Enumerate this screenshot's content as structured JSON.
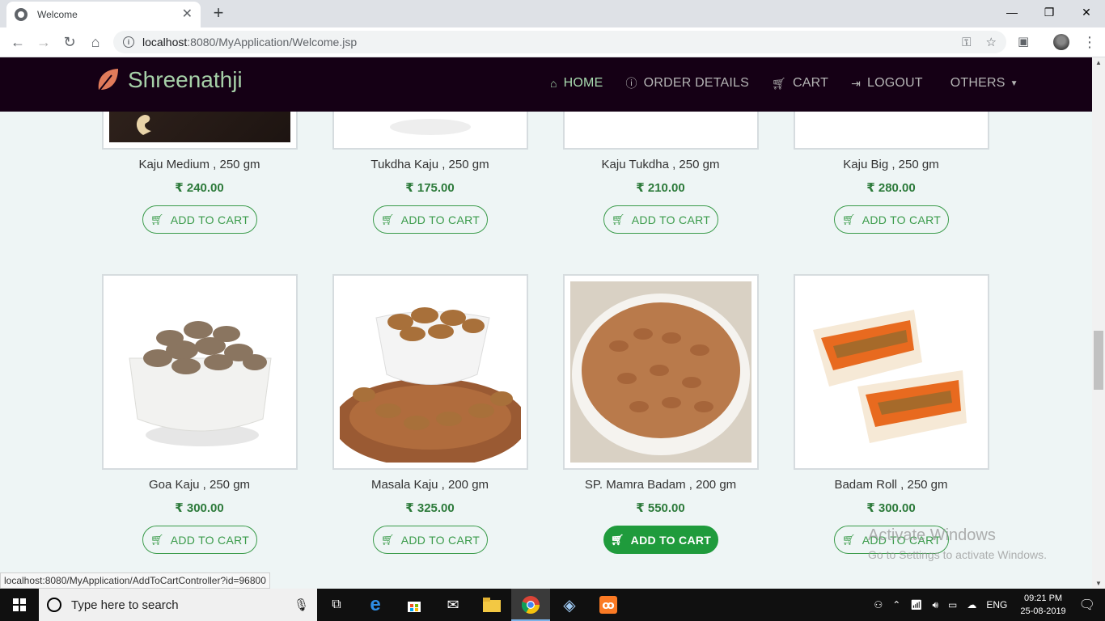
{
  "browser": {
    "tab_title": "Welcome",
    "url_host": "localhost",
    "url_rest": ":8080/MyApplication/Welcome.jsp",
    "status_url": "localhost:8080/MyApplication/AddToCartController?id=96800"
  },
  "navbar": {
    "brand": "Shreenathji",
    "links": [
      {
        "label": "HOME",
        "icon": "home-icon"
      },
      {
        "label": "ORDER DETAILS",
        "icon": "info-icon"
      },
      {
        "label": "CART",
        "icon": "cart-icon"
      },
      {
        "label": "LOGOUT",
        "icon": "logout-icon"
      },
      {
        "label": "OTHERS",
        "icon": "caret-down-icon"
      }
    ],
    "active_color": "#a9dcb0",
    "bg_color": "#150015"
  },
  "products": [
    {
      "name": "Kaju Medium , 250 gm",
      "price": "₹ 240.00",
      "button": "ADD TO CART"
    },
    {
      "name": "Tukdha Kaju , 250 gm",
      "price": "₹ 175.00",
      "button": "ADD TO CART"
    },
    {
      "name": "Kaju Tukdha , 250 gm",
      "price": "₹ 210.00",
      "button": "ADD TO CART"
    },
    {
      "name": "Kaju Big , 250 gm",
      "price": "₹ 280.00",
      "button": "ADD TO CART"
    },
    {
      "name": "Goa Kaju , 250 gm",
      "price": "₹ 300.00",
      "button": "ADD TO CART"
    },
    {
      "name": "Masala Kaju , 200 gm",
      "price": "₹ 325.00",
      "button": "ADD TO CART"
    },
    {
      "name": "SP. Mamra Badam , 200 gm",
      "price": "₹ 550.00",
      "button": "ADD TO CART"
    },
    {
      "name": "Badam Roll , 250 gm",
      "price": "₹ 300.00",
      "button": "ADD TO CART"
    }
  ],
  "watermark": {
    "line1": "Activate Windows",
    "line2": "Go to Settings to activate Windows."
  },
  "taskbar": {
    "search_placeholder": "Type here to search",
    "lang": "ENG",
    "time": "09:21 PM",
    "date": "25-08-2019"
  }
}
